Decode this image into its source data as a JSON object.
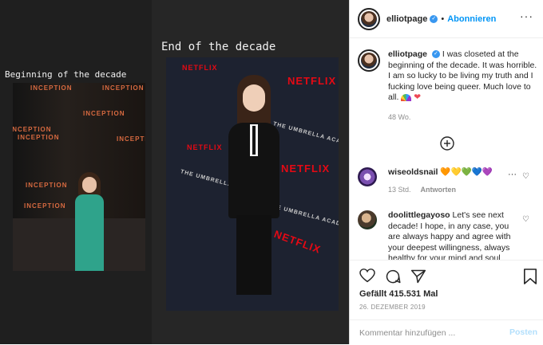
{
  "story": {
    "caption_left": "Beginning of the decade",
    "caption_right": "End of the decade",
    "brand_left": "INCEPTION",
    "brand_right_primary": "NETFLIX",
    "brand_right_secondary": "THE UMBRELLA ACADEMY"
  },
  "header": {
    "username": "elliotpage",
    "verified_icon": "✓",
    "separator": "•",
    "follow_label": "Abonnieren",
    "more_icon": "···"
  },
  "caption": {
    "username": "elliotpage",
    "verified_icon": "✓",
    "text": "I was closeted at the beginning of the decade. It was horrible. I am so lucky to be living my truth and I fucking love being queer. Much love to all.",
    "emoji_heart": "❤",
    "time": "48 Wo."
  },
  "comments": [
    {
      "username": "wiseoldsnail",
      "emojis": [
        "🧡",
        "💛",
        "💚",
        "💙",
        "💜"
      ],
      "time": "13 Std.",
      "reply_label": "Antworten"
    },
    {
      "username": "doolittlegayoso",
      "text": "Let's see next decade! I hope, in any case, you are always happy and agree with your deepest willingness, always healthy for your mind and soul"
    }
  ],
  "actions": {
    "likes": "Gefällt 415.531 Mal",
    "date": "26. DEZEMBER 2019",
    "comment_placeholder": "Kommentar hinzufügen ...",
    "post_label": "Posten"
  },
  "colors": {
    "accent": "#0095f6",
    "verified": "#3897f0",
    "netflix": "#e50914",
    "dress": "#2fa38b"
  }
}
